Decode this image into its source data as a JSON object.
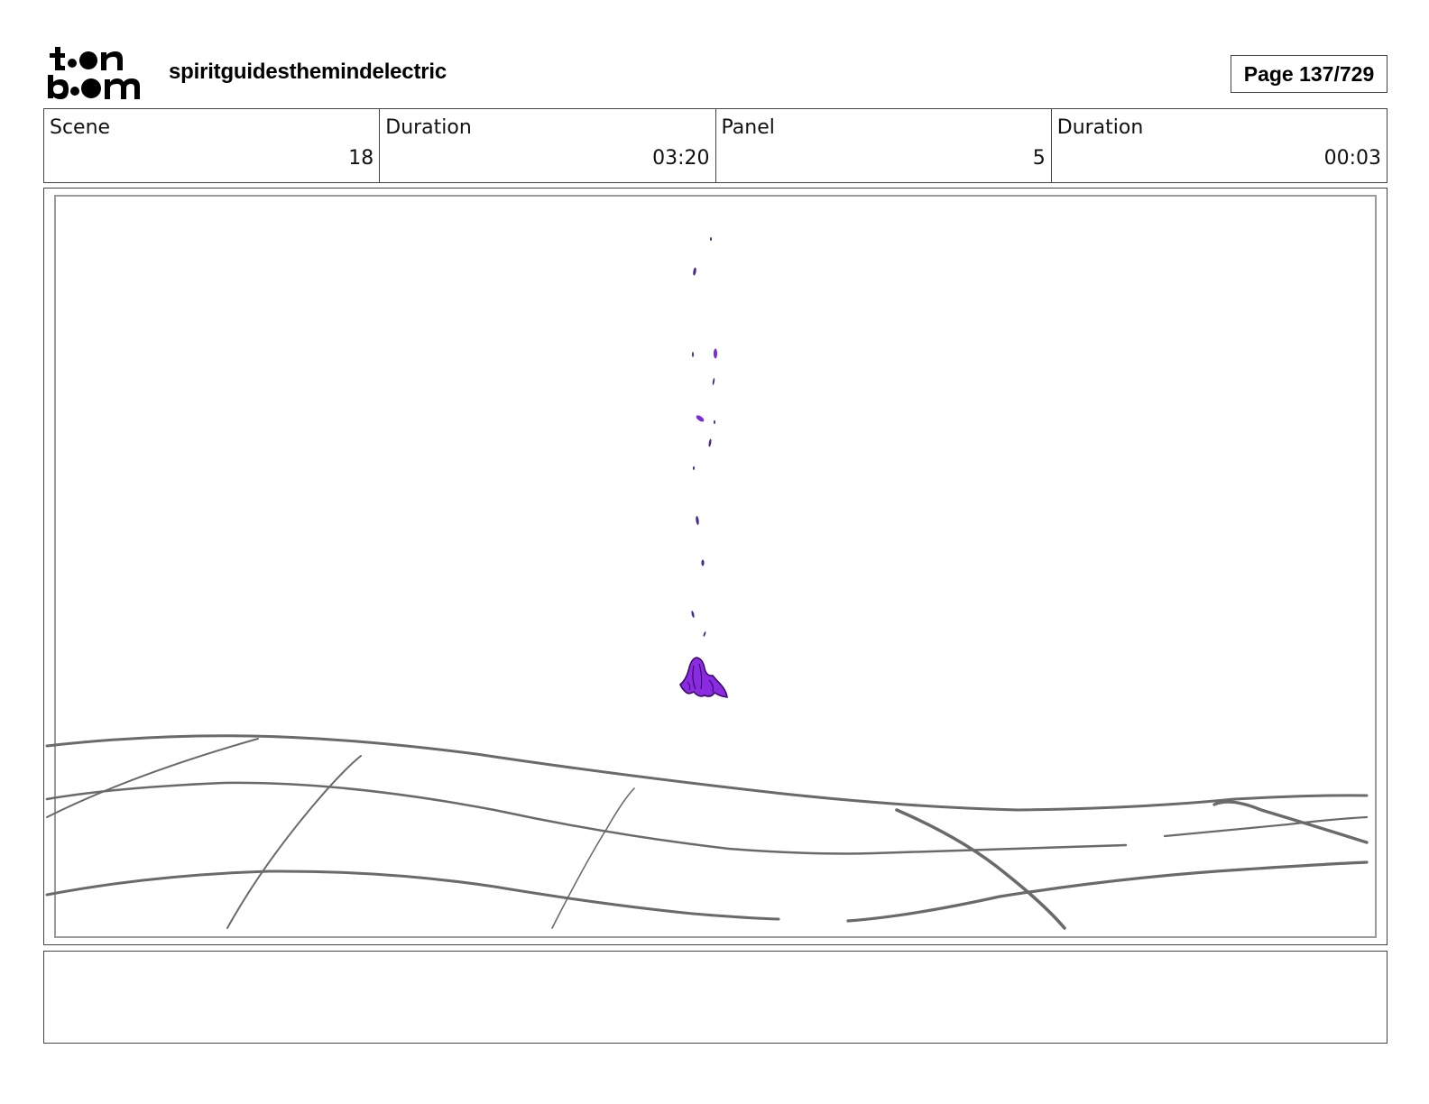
{
  "header": {
    "logo": {
      "line1": "toon",
      "line2": "boom"
    },
    "project_title": "spiritguidesthemindelectric",
    "page_indicator": "Page 137/729"
  },
  "info": {
    "scene": {
      "label": "Scene",
      "value": "18"
    },
    "scene_duration": {
      "label": "Duration",
      "value": "03:20"
    },
    "panel": {
      "label": "Panel",
      "value": "5"
    },
    "panel_duration": {
      "label": "Duration",
      "value": "00:03"
    }
  },
  "notes": {
    "text": ""
  },
  "colors": {
    "figure_fill": "#8a2be2",
    "figure_outline": "#3a0a6a",
    "ground_lines": "#6a6a6a"
  }
}
